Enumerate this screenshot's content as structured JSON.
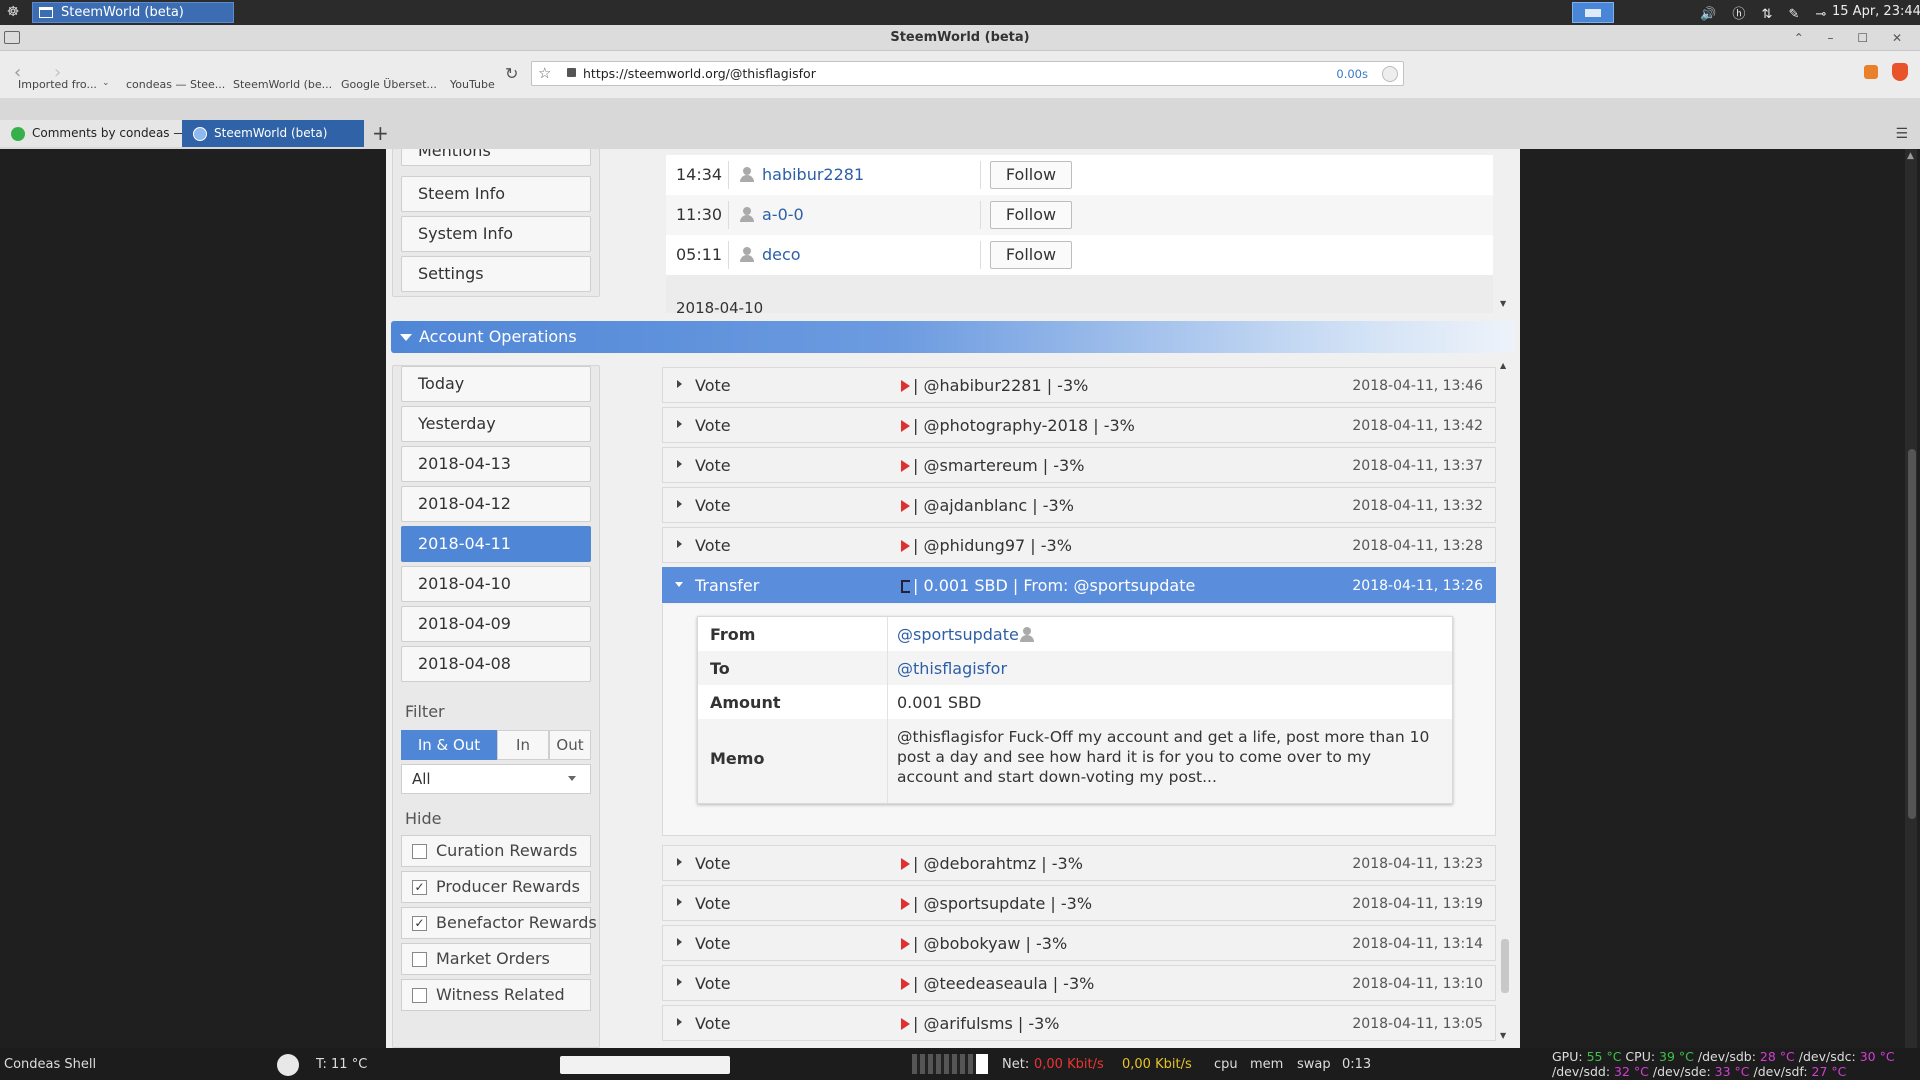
{
  "os_top": {
    "task_label": "SteemWorld (beta)",
    "tray_icons": [
      "volume-icon",
      "hp-icon",
      "network-icon",
      "edit-icon",
      "power-icon"
    ],
    "clock": "15 Apr, 23:44"
  },
  "window": {
    "title": "SteemWorld (beta)"
  },
  "nav": {
    "url": "https://steemworld.org/@thisflagisfor",
    "load_time": "0.00s"
  },
  "bookmarks": [
    "Imported fro...",
    "condeas — Stee...",
    "SteemWorld (be...",
    "Google Überset...",
    "YouTube"
  ],
  "tabs": [
    {
      "label": "Comments by condeas —"
    },
    {
      "label": "SteemWorld (beta)"
    }
  ],
  "sidebar_top": {
    "partial_label": "Mentions",
    "items": [
      "Steem Info",
      "System Info",
      "Settings"
    ]
  },
  "followers": [
    {
      "time": "14:34",
      "user": "habibur2281",
      "action": "Follow"
    },
    {
      "time": "11:30",
      "user": "a-0-0",
      "action": "Follow"
    },
    {
      "time": "05:11",
      "user": "deco",
      "action": "Follow"
    }
  ],
  "followers_next_date": "2018-04-10",
  "account_ops": {
    "title": "Account Operations",
    "days": [
      "Today",
      "Yesterday",
      "2018-04-13",
      "2018-04-12",
      "2018-04-11",
      "2018-04-10",
      "2018-04-09",
      "2018-04-08"
    ],
    "selected_day": "2018-04-11",
    "filter_label": "Filter",
    "filter_options": [
      "In & Out",
      "In",
      "Out"
    ],
    "filter_selected": "In & Out",
    "type_select": "All",
    "hide_label": "Hide",
    "hide_options": [
      {
        "label": "Curation Rewards",
        "checked": false
      },
      {
        "label": "Producer Rewards",
        "checked": true
      },
      {
        "label": "Benefactor Rewards",
        "checked": true
      },
      {
        "label": "Market Orders",
        "checked": false
      },
      {
        "label": "Witness Related",
        "checked": false
      }
    ]
  },
  "ops_before": [
    {
      "type": "Vote",
      "desc": "| @habibur2281 | -3%",
      "date": "2018-04-11, 13:46"
    },
    {
      "type": "Vote",
      "desc": "| @photography-2018 | -3%",
      "date": "2018-04-11, 13:42"
    },
    {
      "type": "Vote",
      "desc": "| @smartereum | -3%",
      "date": "2018-04-11, 13:37"
    },
    {
      "type": "Vote",
      "desc": "| @ajdanblanc | -3%",
      "date": "2018-04-11, 13:32"
    },
    {
      "type": "Vote",
      "desc": "| @phidung97 | -3%",
      "date": "2018-04-11, 13:28"
    }
  ],
  "transfer": {
    "type": "Transfer",
    "desc": "| 0.001 SBD | From: @sportsupdate",
    "date": "2018-04-11, 13:26",
    "from_label": "From",
    "from": "@sportsupdate",
    "to_label": "To",
    "to": "@thisflagisfor",
    "amount_label": "Amount",
    "amount": "0.001 SBD",
    "memo_label": "Memo",
    "memo": "@thisflagisfor Fuck-Off my account and get a life, post more than 10 post a day and see how hard it is for you to come over to my account and start down-voting my post..."
  },
  "ops_after": [
    {
      "type": "Vote",
      "desc": "| @deborahtmz | -3%",
      "date": "2018-04-11, 13:23"
    },
    {
      "type": "Vote",
      "desc": "| @sportsupdate | -3%",
      "date": "2018-04-11, 13:19"
    },
    {
      "type": "Vote",
      "desc": "| @bobokyaw | -3%",
      "date": "2018-04-11, 13:14"
    },
    {
      "type": "Vote",
      "desc": "| @teedeaseaula | -3%",
      "date": "2018-04-11, 13:10"
    },
    {
      "type": "Vote",
      "desc": "| @arifulsms | -3%",
      "date": "2018-04-11, 13:05"
    }
  ],
  "os_bottom": {
    "shell": "Condeas Shell",
    "temp": "T: 11 °C",
    "net_label": "Net:",
    "net_down": "0,00 Kbit/s",
    "net_up": "0,00 Kbit/s",
    "cpu": "cpu",
    "mem": "mem",
    "swap": "swap",
    "uptime": "0:13",
    "gpu_label": "GPU:",
    "gpu_temp": "55 °C",
    "cpu_label": "CPU:",
    "cpu_temp": "39 °C",
    "sdb_label": "/dev/sdb:",
    "sdb_temp": "28 °C",
    "sdc_label": "/dev/sdc:",
    "sdc_temp": "30 °C",
    "sdd_label": "/dev/sdd:",
    "sdd_temp": "32 °C",
    "sde_label": "/dev/sde:",
    "sde_temp": "33 °C",
    "sdf_label": "/dev/sdf:",
    "sdf_temp": "27 °C"
  }
}
